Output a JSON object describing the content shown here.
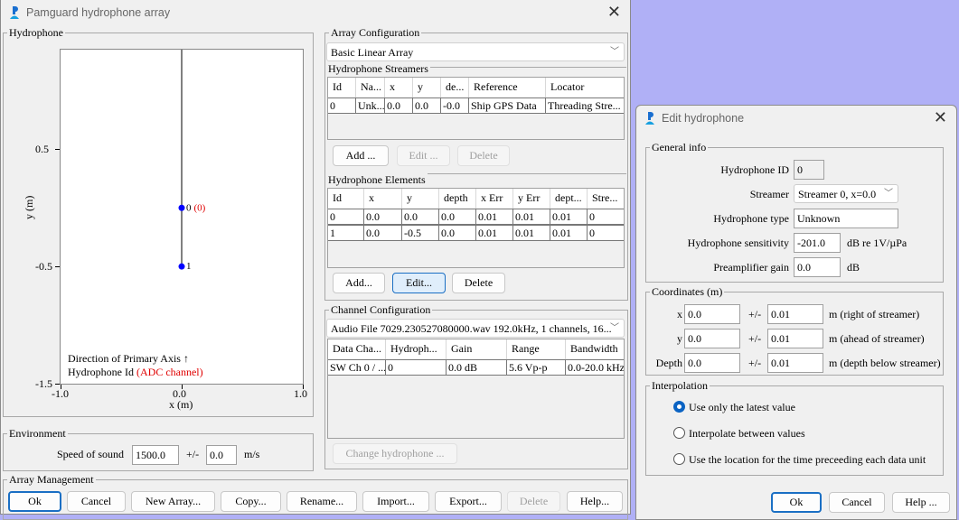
{
  "main_window": {
    "title": "Pamguard hydrophone array",
    "close": "✕"
  },
  "hydrophone_panel": {
    "label": "Hydrophone",
    "plot": {
      "x_label": "x (m)",
      "y_label": "y (m)",
      "x_ticks": [
        "-1.0",
        "0.0",
        "1.0"
      ],
      "y_ticks": [
        "0.5",
        "-0.5",
        "-1.5"
      ],
      "x_range": [
        -1,
        1
      ],
      "y_range": [
        -1.5,
        1.35
      ],
      "hydrophones": [
        {
          "id": "0",
          "channel": "(0)",
          "x": 0,
          "y": 0
        },
        {
          "id": "1",
          "channel": "",
          "x": 0,
          "y": -0.5
        }
      ],
      "legend_direction": "Direction of Primary Axis ↑",
      "legend_id": "Hydrophone Id",
      "legend_channel": "(ADC channel)",
      "point_color": "#0000ff",
      "channel_color": "#e00000"
    }
  },
  "environment": {
    "label": "Environment",
    "speed_label": "Speed of sound",
    "speed": "1500.0",
    "pm": "+/-",
    "error": "0.0",
    "unit": "m/s"
  },
  "array_management": {
    "label": "Array Management",
    "buttons": [
      "Ok",
      "Cancel",
      "New Array...",
      "Copy...",
      "Rename...",
      "Import...",
      "Export...",
      "Delete",
      "Help..."
    ]
  },
  "array_configuration": {
    "label": "Array Configuration",
    "array_select": "Basic Linear Array"
  },
  "streamers": {
    "label": "Hydrophone Streamers",
    "columns": [
      "Id",
      "Na...",
      "x",
      "y",
      "de...",
      "Reference",
      "Locator"
    ],
    "rows": [
      [
        "0",
        "Unk...",
        "0.0",
        "0.0",
        "-0.0",
        "Ship GPS Data",
        "Threading Stre..."
      ]
    ],
    "buttons": {
      "add": "Add ...",
      "edit": "Edit ...",
      "delete": "Delete"
    }
  },
  "elements": {
    "label": "Hydrophone Elements",
    "columns": [
      "Id",
      "x",
      "y",
      "depth",
      "x Err",
      "y Err",
      "dept...",
      "Stre..."
    ],
    "rows": [
      [
        "0",
        "0.0",
        "0.0",
        "0.0",
        "0.01",
        "0.01",
        "0.01",
        "0"
      ],
      [
        "1",
        "0.0",
        "-0.5",
        "0.0",
        "0.01",
        "0.01",
        "0.01",
        "0"
      ]
    ],
    "selected_row": 0,
    "buttons": {
      "add": "Add...",
      "edit": "Edit...",
      "delete": "Delete"
    }
  },
  "channel_configuration": {
    "label": "Channel Configuration",
    "source_select": "Audio File 7029.230527080000.wav 192.0kHz, 1 channels, 16...",
    "columns": [
      "Data Cha...",
      "Hydroph...",
      "Gain",
      "Range",
      "Bandwidth"
    ],
    "rows": [
      [
        "SW Ch 0 / ...",
        "0",
        "0.0 dB",
        "5.6 Vp-p",
        "0.0-20.0 kHz"
      ]
    ],
    "change_button": "Change hydrophone ..."
  },
  "edit_dialog": {
    "title": "Edit hydrophone",
    "close": "✕",
    "general": {
      "label": "General info",
      "id_label": "Hydrophone ID",
      "id": "0",
      "streamer_label": "Streamer",
      "streamer": "Streamer 0, x=0.0",
      "type_label": "Hydrophone type",
      "type": "Unknown",
      "sens_label": "Hydrophone sensitivity",
      "sens": "-201.0",
      "sens_unit": "dB re 1V/µPa",
      "gain_label": "Preamplifier gain",
      "gain": "0.0",
      "gain_unit": "dB"
    },
    "coords": {
      "label": "Coordinates (m)",
      "pm": "+/-",
      "rows": [
        {
          "label": "x",
          "value": "0.0",
          "err": "0.01",
          "unit": "m (right of streamer)"
        },
        {
          "label": "y",
          "value": "0.0",
          "err": "0.01",
          "unit": "m (ahead of streamer)"
        },
        {
          "label": "Depth",
          "value": "0.0",
          "err": "0.01",
          "unit": "m (depth below streamer)"
        }
      ]
    },
    "interpolation": {
      "label": "Interpolation",
      "options": [
        "Use only the latest value",
        "Interpolate between values",
        "Use the location for the time preceeding each data unit"
      ],
      "selected": 0
    },
    "buttons": {
      "ok": "Ok",
      "cancel": "Cancel",
      "help": "Help ..."
    }
  }
}
